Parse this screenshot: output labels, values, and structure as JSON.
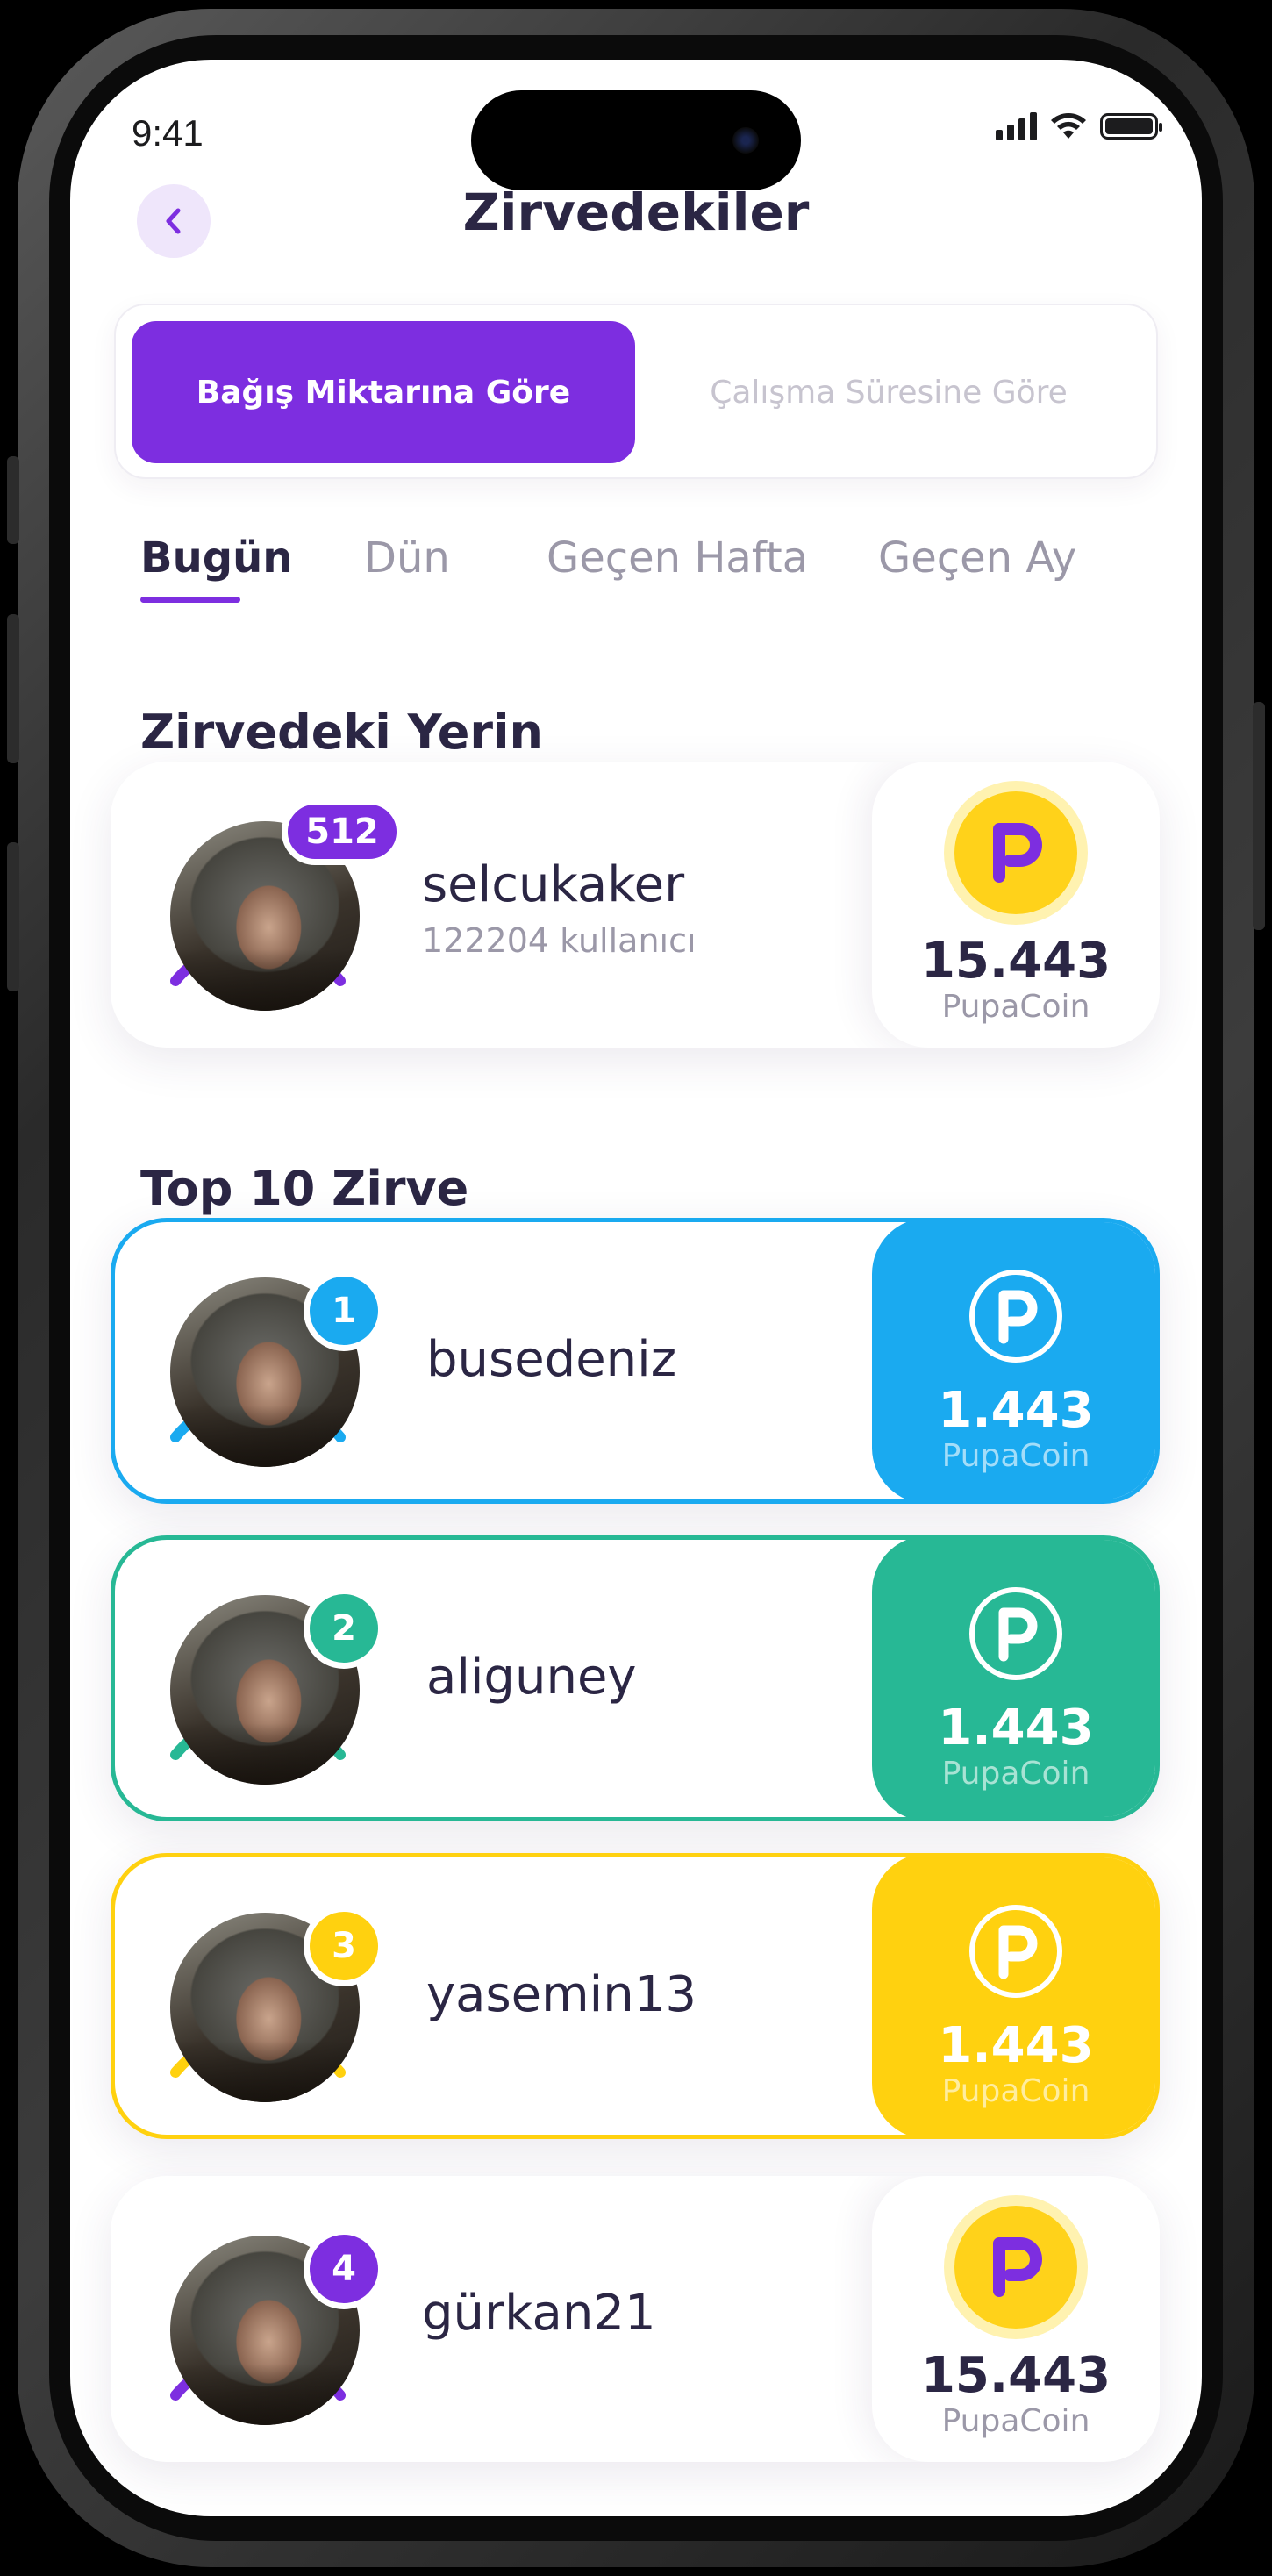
{
  "status_bar": {
    "time": "9:41"
  },
  "header": {
    "title": "Zirvedekiler",
    "back_icon": "chevron-left-icon"
  },
  "segment": {
    "active_label": "Bağış Miktarına Göre",
    "inactive_label": "Çalışma Süresine Göre"
  },
  "tabs": [
    {
      "label": "Bugün",
      "active": true
    },
    {
      "label": "Dün",
      "active": false
    },
    {
      "label": "Geçen Hafta",
      "active": false
    },
    {
      "label": "Geçen Ay",
      "active": false
    }
  ],
  "my_rank": {
    "section_title": "Zirvedeki Yerin",
    "rank": "512",
    "username": "selcukaker",
    "subtext": "122204 kullanıcı",
    "coin_value": "15.443",
    "coin_label": "PupaCoin"
  },
  "top10": {
    "section_title": "Top 10 Zirve",
    "entries": [
      {
        "rank": "1",
        "username": "busedeniz",
        "coin_value": "1.443",
        "coin_label": "PupaCoin",
        "color": "#1aaaf0"
      },
      {
        "rank": "2",
        "username": "aliguney",
        "coin_value": "1.443",
        "coin_label": "PupaCoin",
        "color": "#27b895"
      },
      {
        "rank": "3",
        "username": "yasemin13",
        "coin_value": "1.443",
        "coin_label": "PupaCoin",
        "color": "#ffd10f"
      },
      {
        "rank": "4",
        "username": "gürkan21",
        "coin_value": "15.443",
        "coin_label": "PupaCoin",
        "color": "#7d2ee0"
      }
    ]
  },
  "colors": {
    "accent": "#7d2ee0",
    "text": "#2b2644",
    "muted": "#9b98a8",
    "coin_gold": "#ffd21a"
  }
}
